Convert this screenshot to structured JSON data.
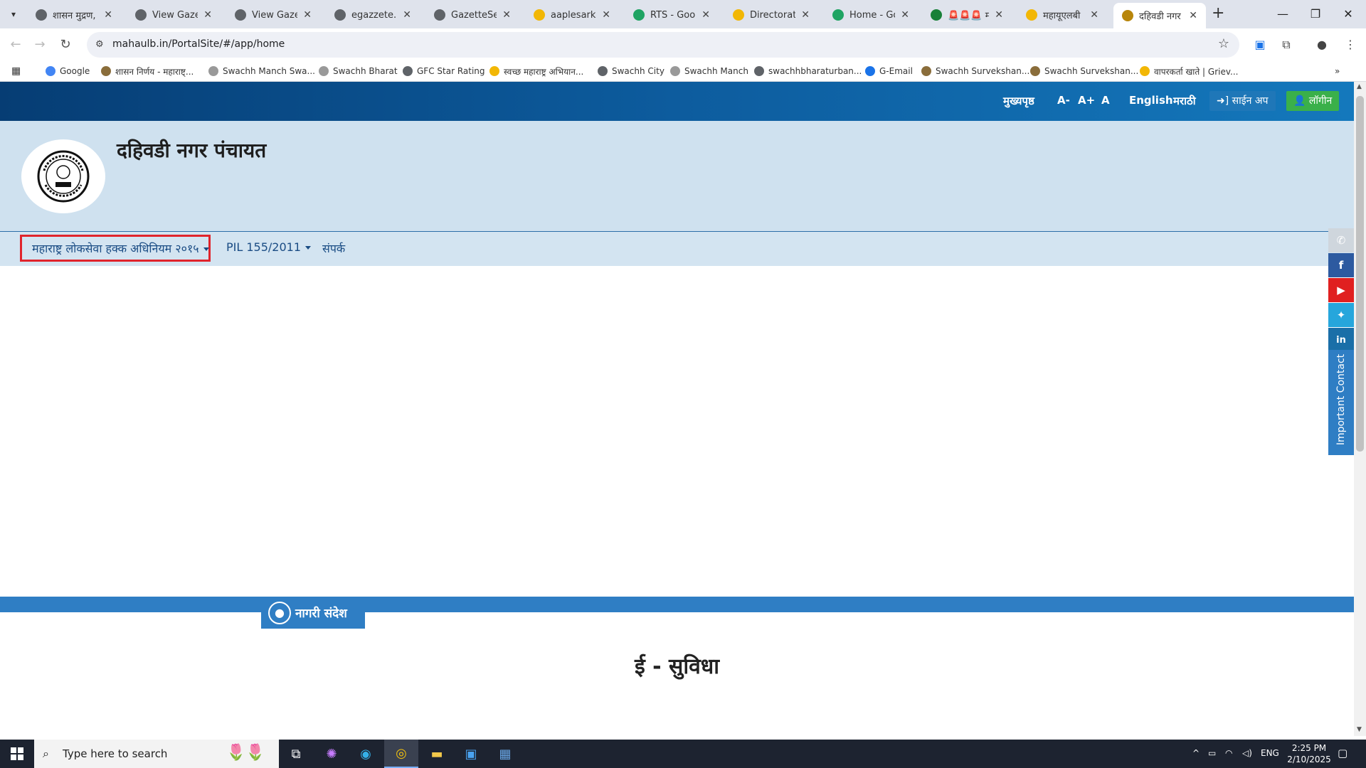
{
  "browser": {
    "tabs": [
      {
        "title": "शासन मुद्रण, ले",
        "active": false,
        "favicon_color": "#5f6368"
      },
      {
        "title": "View Gazette",
        "active": false,
        "favicon_color": "#5f6368"
      },
      {
        "title": "View Gazette",
        "active": false,
        "favicon_color": "#5f6368"
      },
      {
        "title": "egazzete.ma",
        "active": false,
        "favicon_color": "#5f6368"
      },
      {
        "title": "GazetteSearc",
        "active": false,
        "favicon_color": "#5f6368"
      },
      {
        "title": "aaplesarkar.",
        "active": false,
        "favicon_color": "#f2b705"
      },
      {
        "title": "RTS - Google",
        "active": false,
        "favicon_color": "#1fa463"
      },
      {
        "title": "Directorate c",
        "active": false,
        "favicon_color": "#f2b705"
      },
      {
        "title": "Home - Goo",
        "active": false,
        "favicon_color": "#1fa463"
      },
      {
        "title": "🚨🚨🚨 महा",
        "active": false,
        "favicon_color": "#188038"
      },
      {
        "title": "महायूएलबी",
        "active": false,
        "favicon_color": "#f2b705"
      },
      {
        "title": "दहिवडी नगर प",
        "active": true,
        "favicon_color": "#b8860b"
      }
    ],
    "url": "mahaulb.in/PortalSite/#/app/home",
    "bookmarks": [
      {
        "label": "Google",
        "color": "#4285f4"
      },
      {
        "label": "शासन निर्णय - महाराष्ट्...",
        "color": "#8a6d3b"
      },
      {
        "label": "Swachh Manch Swa...",
        "color": "#999999"
      },
      {
        "label": "Swachh Bharat",
        "color": "#999999"
      },
      {
        "label": "GFC Star Rating",
        "color": "#5f6368"
      },
      {
        "label": "स्वच्छ महाराष्ट्र अभियान...",
        "color": "#f2b705"
      },
      {
        "label": "Swachh City",
        "color": "#5f6368"
      },
      {
        "label": "Swachh Manch",
        "color": "#999999"
      },
      {
        "label": "swachhbharaturban...",
        "color": "#5f6368"
      },
      {
        "label": "G-Email",
        "color": "#1a73e8"
      },
      {
        "label": "Swachh Survekshan...",
        "color": "#8a6d3b"
      },
      {
        "label": "Swachh Survekshan...",
        "color": "#8a6d3b"
      },
      {
        "label": "वापरकर्ता खाते | Griev...",
        "color": "#f2b705"
      }
    ]
  },
  "site": {
    "topnav": {
      "home": "मुख्यपृष्ठ",
      "font_minus": "A-",
      "font_plus": "A+",
      "font_reset": "A",
      "lang_en": "English",
      "lang_mr": "मराठी",
      "signup": "साईन अप",
      "login": "लॉगीन"
    },
    "title": "दहिवडी नगर पंचायत",
    "logo_text": "नगरपंचायत दहिवडी",
    "menu": [
      {
        "label": "महाराष्ट्र लोकसेवा हक्क अधिनियम २०१५",
        "dropdown": true,
        "highlighted": true
      },
      {
        "label": "PIL 155/2011",
        "dropdown": true,
        "highlighted": false
      },
      {
        "label": "संपर्क",
        "dropdown": false,
        "highlighted": false
      }
    ],
    "nagari_sandesh": "नागरी संदेश",
    "e_suvidha": "ई - सुविधा",
    "important_contact": "Important Contact",
    "colors": {
      "topbar": "#0d5c9e",
      "header_bg": "#cfe1ef",
      "accent": "#2f7ec4",
      "login_green": "#3ab04a",
      "highlight_red": "#e0242c"
    }
  },
  "taskbar": {
    "search_placeholder": "Type here to search",
    "lang": "ENG",
    "time": "2:25 PM",
    "date": "2/10/2025"
  }
}
